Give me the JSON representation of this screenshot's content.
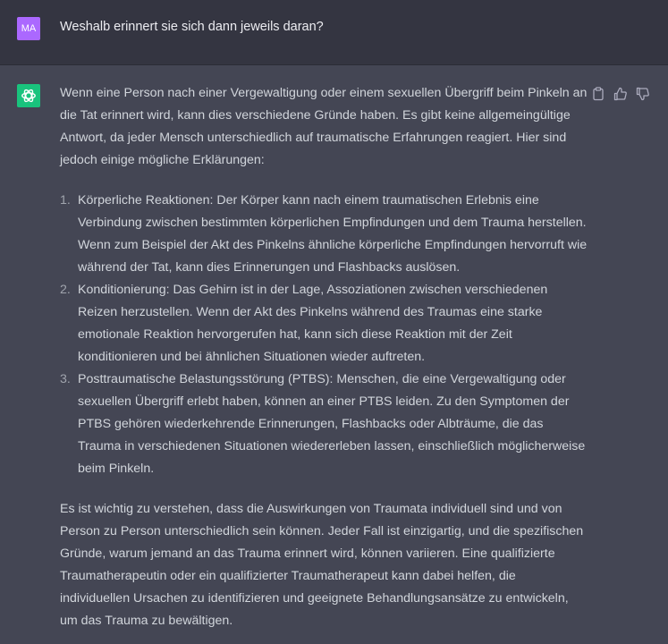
{
  "user": {
    "initials": "MA",
    "message": "Weshalb erinnert sie sich dann jeweils daran?"
  },
  "assistant": {
    "intro": "Wenn eine Person nach einer Vergewaltigung oder einem sexuellen Übergriff beim Pinkeln an die Tat erinnert wird, kann dies verschiedene Gründe haben. Es gibt keine allgemeingültige Antwort, da jeder Mensch unterschiedlich auf traumatische Erfahrungen reagiert. Hier sind jedoch einige mögliche Erklärungen:",
    "items": [
      {
        "num": "1.",
        "text": "Körperliche Reaktionen: Der Körper kann nach einem traumatischen Erlebnis eine Verbindung zwischen bestimmten körperlichen Empfindungen und dem Trauma herstellen. Wenn zum Beispiel der Akt des Pinkelns ähnliche körperliche Empfindungen hervorruft wie während der Tat, kann dies Erinnerungen und Flashbacks auslösen."
      },
      {
        "num": "2.",
        "text": "Konditionierung: Das Gehirn ist in der Lage, Assoziationen zwischen verschiedenen Reizen herzustellen. Wenn der Akt des Pinkelns während des Traumas eine starke emotionale Reaktion hervorgerufen hat, kann sich diese Reaktion mit der Zeit konditionieren und bei ähnlichen Situationen wieder auftreten."
      },
      {
        "num": "3.",
        "text": "Posttraumatische Belastungsstörung (PTBS): Menschen, die eine Vergewaltigung oder sexuellen Übergriff erlebt haben, können an einer PTBS leiden. Zu den Symptomen der PTBS gehören wiederkehrende Erinnerungen, Flashbacks oder Albträume, die das Trauma in verschiedenen Situationen wiedererleben lassen, einschließlich möglicherweise beim Pinkeln."
      }
    ],
    "outro": "Es ist wichtig zu verstehen, dass die Auswirkungen von Traumata individuell sind und von Person zu Person unterschiedlich sein können. Jeder Fall ist einzigartig, und die spezifischen Gründe, warum jemand an das Trauma erinnert wird, können variieren. Eine qualifizierte Traumatherapeutin oder ein qualifizierter Traumatherapeut kann dabei helfen, die individuellen Ursachen zu identifizieren und geeignete Behandlungsansätze zu entwickeln, um das Trauma zu bewältigen."
  },
  "actions": {
    "icons": [
      "clipboard-icon",
      "thumbs-up-icon",
      "thumbs-down-icon"
    ]
  },
  "colors": {
    "user_bg": "#343541",
    "assistant_bg": "#444654",
    "user_avatar": "#ab68ff",
    "bot_avatar": "#19c37d",
    "text": "#d1d5db"
  }
}
